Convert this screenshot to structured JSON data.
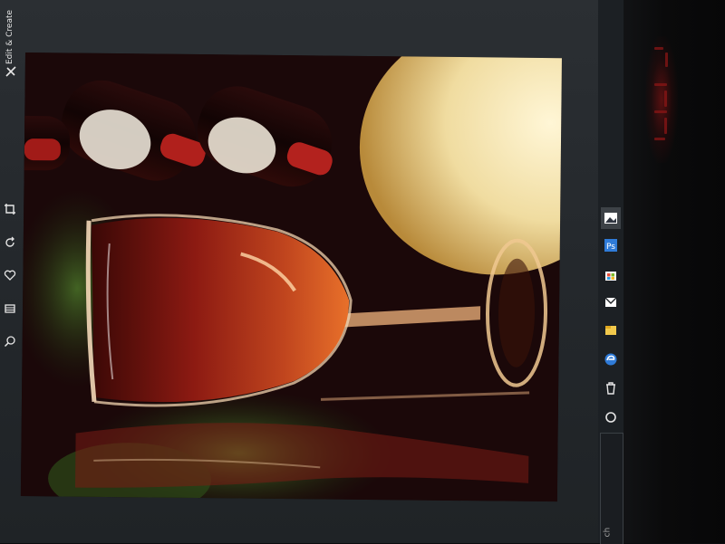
{
  "app": {
    "edit_create_label": "Edit & Create"
  },
  "toolbar": {
    "icons": [
      "crop-icon",
      "rotate-icon",
      "favorite-icon",
      "filmstrip-icon",
      "zoom-icon"
    ]
  },
  "taskbar": {
    "icons": [
      "photos-icon",
      "word-icon",
      "store-icon",
      "mail-icon",
      "explorer-icon",
      "edge-icon",
      "trash-icon",
      "cortana-icon"
    ],
    "bottom_text": "ch"
  },
  "colors": {
    "accent": "#2f7bd8",
    "wine": "#8c1a14",
    "candle": "#f2e3b0"
  }
}
